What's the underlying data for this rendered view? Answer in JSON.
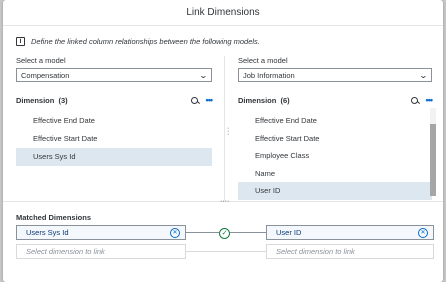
{
  "dialog": {
    "title": "Link Dimensions",
    "info_icon": "info-icon",
    "info_text": "Define the linked column relationships between the following models."
  },
  "left": {
    "model_label": "Select a model",
    "model_value": "Compensation",
    "dimension_title": "Dimension",
    "dimension_count": "(3)",
    "items": [
      {
        "label": "Effective End Date",
        "selected": false
      },
      {
        "label": "Effective Start Date",
        "selected": false
      },
      {
        "label": "Users Sys Id",
        "selected": true
      }
    ]
  },
  "right": {
    "model_label": "Select a model",
    "model_value": "Job Information",
    "dimension_title": "Dimension",
    "dimension_count": "(6)",
    "items": [
      {
        "label": "Effective End Date",
        "selected": false
      },
      {
        "label": "Effective Start Date",
        "selected": false
      },
      {
        "label": "Employee Class",
        "selected": false
      },
      {
        "label": "Name",
        "selected": false
      },
      {
        "label": "User ID",
        "selected": true
      }
    ]
  },
  "matched": {
    "title": "Matched Dimensions",
    "left_value": "Users Sys Id",
    "right_value": "User ID",
    "placeholder": "Select dimension to link"
  },
  "colors": {
    "accent": "#0a6ed1",
    "selected_bg": "#dde7ef",
    "success": "#107e3e"
  }
}
